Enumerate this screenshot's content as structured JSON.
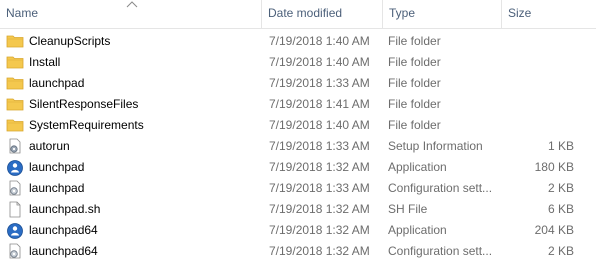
{
  "columns": {
    "name": "Name",
    "date": "Date modified",
    "type": "Type",
    "size": "Size"
  },
  "sort": {
    "column": "name",
    "direction": "ascending"
  },
  "files": [
    {
      "name": "CleanupScripts",
      "date": "7/19/2018 1:40 AM",
      "type": "File folder",
      "size": "",
      "icon": "folder-icon"
    },
    {
      "name": "Install",
      "date": "7/19/2018 1:40 AM",
      "type": "File folder",
      "size": "",
      "icon": "folder-icon"
    },
    {
      "name": "launchpad",
      "date": "7/19/2018 1:33 AM",
      "type": "File folder",
      "size": "",
      "icon": "folder-icon"
    },
    {
      "name": "SilentResponseFiles",
      "date": "7/19/2018 1:41 AM",
      "type": "File folder",
      "size": "",
      "icon": "folder-icon"
    },
    {
      "name": "SystemRequirements",
      "date": "7/19/2018 1:40 AM",
      "type": "File folder",
      "size": "",
      "icon": "folder-icon"
    },
    {
      "name": "autorun",
      "date": "7/19/2018 1:33 AM",
      "type": "Setup Information",
      "size": "1 KB",
      "icon": "setup-info-icon"
    },
    {
      "name": "launchpad",
      "date": "7/19/2018 1:32 AM",
      "type": "Application",
      "size": "180 KB",
      "icon": "application-icon"
    },
    {
      "name": "launchpad",
      "date": "7/19/2018 1:33 AM",
      "type": "Configuration sett...",
      "size": "2 KB",
      "icon": "config-file-icon"
    },
    {
      "name": "launchpad.sh",
      "date": "7/19/2018 1:32 AM",
      "type": "SH File",
      "size": "6 KB",
      "icon": "blank-file-icon"
    },
    {
      "name": "launchpad64",
      "date": "7/19/2018 1:32 AM",
      "type": "Application",
      "size": "204 KB",
      "icon": "application-icon"
    },
    {
      "name": "launchpad64",
      "date": "7/19/2018 1:32 AM",
      "type": "Configuration sett...",
      "size": "2 KB",
      "icon": "config-file-icon"
    }
  ],
  "colors": {
    "header_text": "#4c607a",
    "secondary_text": "#6d6d6d",
    "folder": "#f4c84e",
    "app_blue": "#2a6cc4"
  }
}
